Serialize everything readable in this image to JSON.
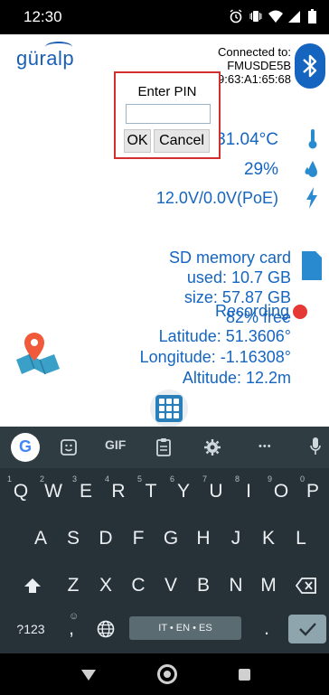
{
  "status_bar": {
    "time": "12:30"
  },
  "header": {
    "logo": "güralp",
    "connected_lines": [
      "Connected to:",
      "FMUSDE5B",
      "9:63:A1:65:68"
    ]
  },
  "pin_dialog": {
    "title": "Enter PIN",
    "pin_value": "",
    "ok_label": "OK",
    "cancel_label": "Cancel"
  },
  "readouts": {
    "temperature": "31.04°C",
    "humidity": "29%",
    "power": "12.0V/0.0V(PoE)",
    "sd_title": "SD memory card",
    "sd_used": "used: 10.7 GB",
    "sd_size": "size: 57.87 GB",
    "sd_free": "82% free",
    "recording": "Recording",
    "latitude": "Latitude: 51.3606°",
    "longitude": "Longitude: -1.16308°",
    "altitude": "Altitude: 12.2m"
  },
  "keyboard": {
    "toolbar": {
      "gif": "GIF",
      "more": "•••"
    },
    "row1": [
      {
        "k": "Q",
        "n": "1"
      },
      {
        "k": "W",
        "n": "2"
      },
      {
        "k": "E",
        "n": "3"
      },
      {
        "k": "R",
        "n": "4"
      },
      {
        "k": "T",
        "n": "5"
      },
      {
        "k": "Y",
        "n": "6"
      },
      {
        "k": "U",
        "n": "7"
      },
      {
        "k": "I",
        "n": "8"
      },
      {
        "k": "O",
        "n": "9"
      },
      {
        "k": "P",
        "n": "0"
      }
    ],
    "row2": [
      "A",
      "S",
      "D",
      "F",
      "G",
      "H",
      "J",
      "K",
      "L"
    ],
    "row3": [
      "Z",
      "X",
      "C",
      "V",
      "B",
      "N",
      "M"
    ],
    "symbols_label": "?123",
    "comma": ",",
    "period": ".",
    "space_label": "IT • EN • ES"
  },
  "colors": {
    "accent": "#1565c0",
    "record": "#e53935",
    "dialog_border": "#d32f2f"
  }
}
